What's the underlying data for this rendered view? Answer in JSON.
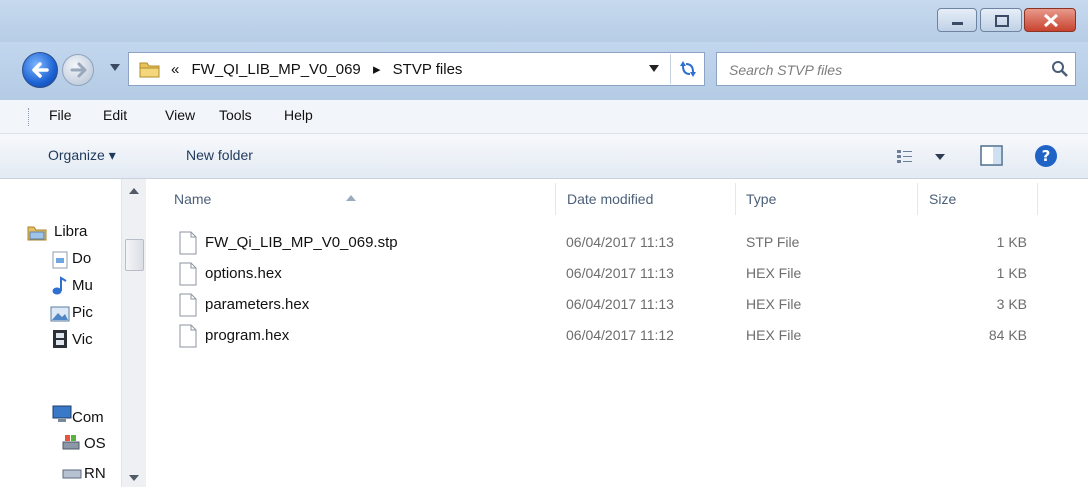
{
  "window": {
    "controls": [
      "minimize",
      "maximize",
      "close"
    ]
  },
  "address": {
    "overflow_glyph": "«",
    "crumbs": [
      "FW_QI_LIB_MP_V0_069",
      "STVP files"
    ],
    "separator": "▸"
  },
  "search": {
    "placeholder": "Search STVP files"
  },
  "menu": {
    "items": [
      "File",
      "Edit",
      "View",
      "Tools",
      "Help"
    ]
  },
  "toolbar": {
    "organize_label": "Organize ▾",
    "new_folder_label": "New folder"
  },
  "nav": {
    "items": [
      {
        "label": "Libra",
        "icon": "libraries-icon"
      },
      {
        "label": "Do",
        "icon": "documents-icon"
      },
      {
        "label": "Mu",
        "icon": "music-icon"
      },
      {
        "label": "Pic",
        "icon": "pictures-icon"
      },
      {
        "label": "Vic",
        "icon": "videos-icon"
      },
      {
        "label": "Com",
        "icon": "computer-icon"
      },
      {
        "label": "OS",
        "icon": "drive-icon"
      },
      {
        "label": "RN",
        "icon": "network-drive-icon"
      }
    ]
  },
  "columns": {
    "name": "Name",
    "date": "Date modified",
    "type": "Type",
    "size": "Size"
  },
  "files": [
    {
      "name": "FW_Qi_LIB_MP_V0_069.stp",
      "date": "06/04/2017 11:13",
      "type": "STP File",
      "size": "1 KB"
    },
    {
      "name": "options.hex",
      "date": "06/04/2017 11:13",
      "type": "HEX File",
      "size": "1 KB"
    },
    {
      "name": "parameters.hex",
      "date": "06/04/2017 11:13",
      "type": "HEX File",
      "size": "3 KB"
    },
    {
      "name": "program.hex",
      "date": "06/04/2017 11:12",
      "type": "HEX File",
      "size": "84 KB"
    }
  ],
  "colors": {
    "chrome": "#b9cfe8",
    "toolbar_text": "#1e395b",
    "close_button": "#c8432f"
  }
}
